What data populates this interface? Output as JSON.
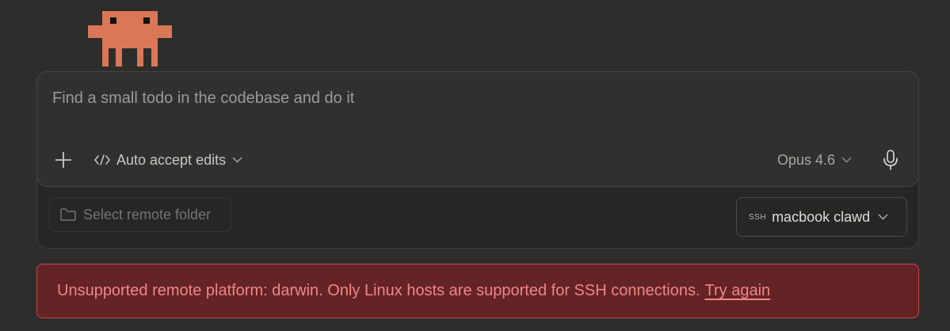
{
  "mascot": {
    "icon": "pixel-creature-icon",
    "color": "#d97757"
  },
  "composer": {
    "placeholder": "Find a small todo in the codebase and do it",
    "add_icon": "plus-icon",
    "mode": {
      "icon": "code-icon",
      "label": "Auto accept edits",
      "chevron": "chevron-down-icon"
    },
    "model": {
      "label": "Opus 4.6",
      "chevron": "chevron-down-icon"
    },
    "mic_icon": "microphone-icon"
  },
  "environment": {
    "folder": {
      "icon": "folder-icon",
      "label": "Select remote folder"
    },
    "ssh": {
      "tag": "SSH",
      "label": "macbook clawd",
      "chevron": "chevron-down-icon"
    }
  },
  "error": {
    "message": "Unsupported remote platform: darwin. Only Linux hosts are supported for SSH connections.",
    "action_label": "Try again",
    "color": "#f08686",
    "background": "#642325"
  }
}
